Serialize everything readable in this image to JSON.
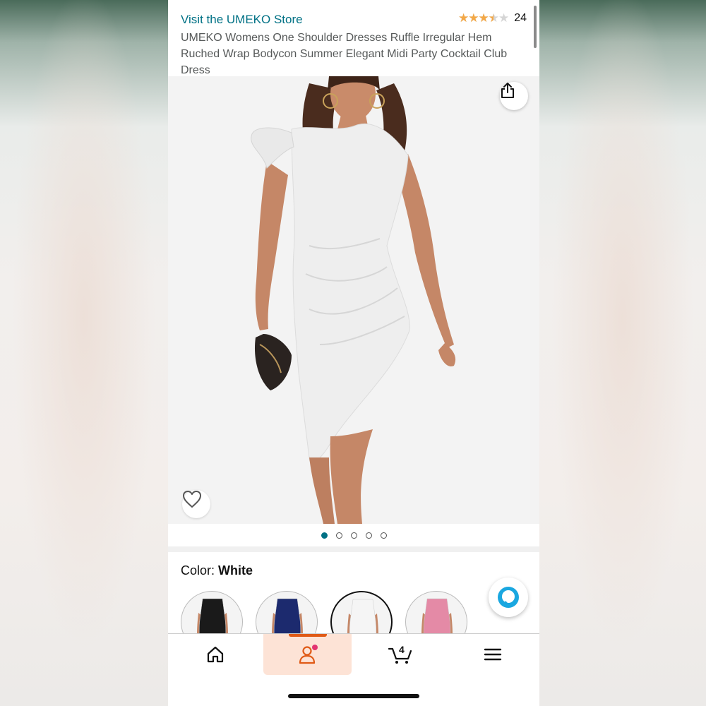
{
  "header": {
    "store_link": "Visit the UMEKO Store",
    "rating": {
      "stars": 3.5,
      "max": 5,
      "count": "24"
    },
    "title": "UMEKO Womens One Shoulder Dresses Ruffle Irregular Hem Ruched Wrap Bodycon Summer Elegant Midi Party Cocktail Club Dress"
  },
  "gallery": {
    "total_images": 5,
    "active_index": 0,
    "share_icon": "share-icon",
    "wishlist_icon": "heart-icon"
  },
  "color": {
    "label": "Color: ",
    "value": "White",
    "swatches": [
      {
        "color": "#1a1a1a",
        "selected": false
      },
      {
        "color": "#1c2a6e",
        "selected": false
      },
      {
        "color": "#f5f5f5",
        "selected": true
      },
      {
        "color": "#e48aa6",
        "selected": false
      }
    ]
  },
  "navbar": {
    "items": [
      {
        "icon": "home-icon",
        "active": false
      },
      {
        "icon": "account-icon",
        "active": true
      },
      {
        "icon": "cart-icon",
        "active": false,
        "count": "4"
      },
      {
        "icon": "menu-icon",
        "active": false
      }
    ]
  },
  "colors": {
    "link": "#007185",
    "star": "#f3a847",
    "nav_active_bg": "#fde3d6",
    "nav_accent": "#e05a16",
    "alexa": "#1aa7e0"
  }
}
